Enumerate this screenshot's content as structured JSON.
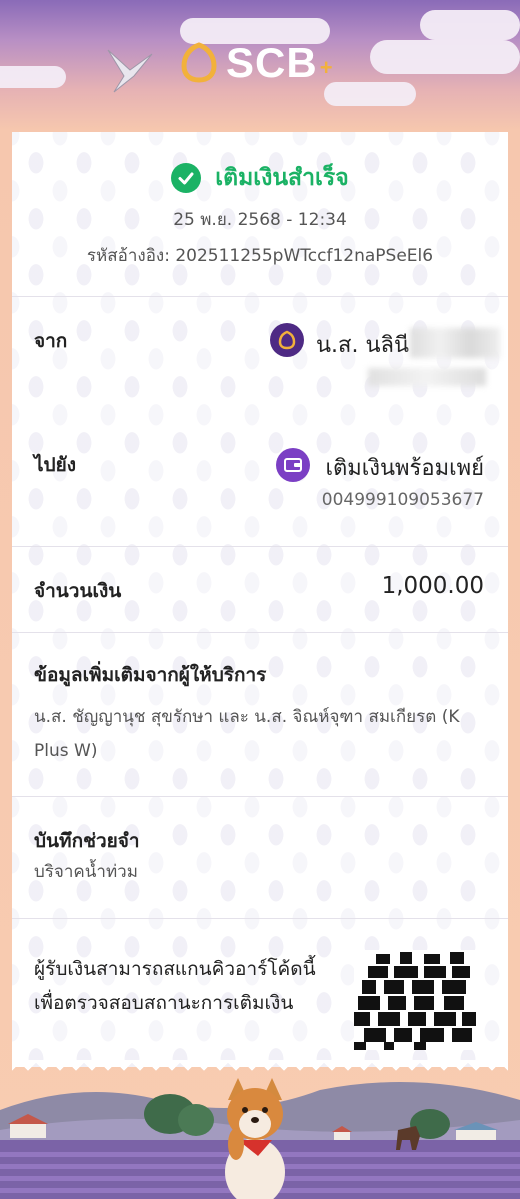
{
  "brand": {
    "name": "SCB",
    "plus": "+"
  },
  "status": {
    "text": "เติมเงินสำเร็จ",
    "datetime": "25 พ.ย. 2568 - 12:34",
    "reference": "รหัสอ้างอิง: 202511255pWTccf12naPSeEl6"
  },
  "from": {
    "label": "จาก",
    "name": "น.ส. นลินี"
  },
  "to": {
    "label": "ไปยัง",
    "name": "เติมเงินพร้อมเพย์",
    "number": "004999109053677"
  },
  "amount": {
    "label": "จำนวนเงิน",
    "value": "1,000.00"
  },
  "extra": {
    "label": "ข้อมูลเพิ่มเติมจากผู้ให้บริการ",
    "text": "น.ส. ชัญญานุช สุขรักษา และ น.ส. จิณห์จุฑา สมเกียรต (K Plus W)"
  },
  "memo": {
    "label": "บันทึกช่วยจำ",
    "text": "บริจาคน้ำท่วม"
  },
  "qr": {
    "line1": "ผู้รับเงินสามารถสแกนคิวอาร์โค้ดนี้",
    "line2": "เพื่อตรวจสอบสถานะการเติมเงิน"
  },
  "colors": {
    "success": "#1bb265",
    "brand_purple": "#4e2a84",
    "brand_gold": "#f2b13b",
    "background": "#f8ccb1"
  },
  "icons": {
    "status": "check-circle-icon",
    "from": "scb-logo-icon",
    "to": "wallet-icon"
  }
}
